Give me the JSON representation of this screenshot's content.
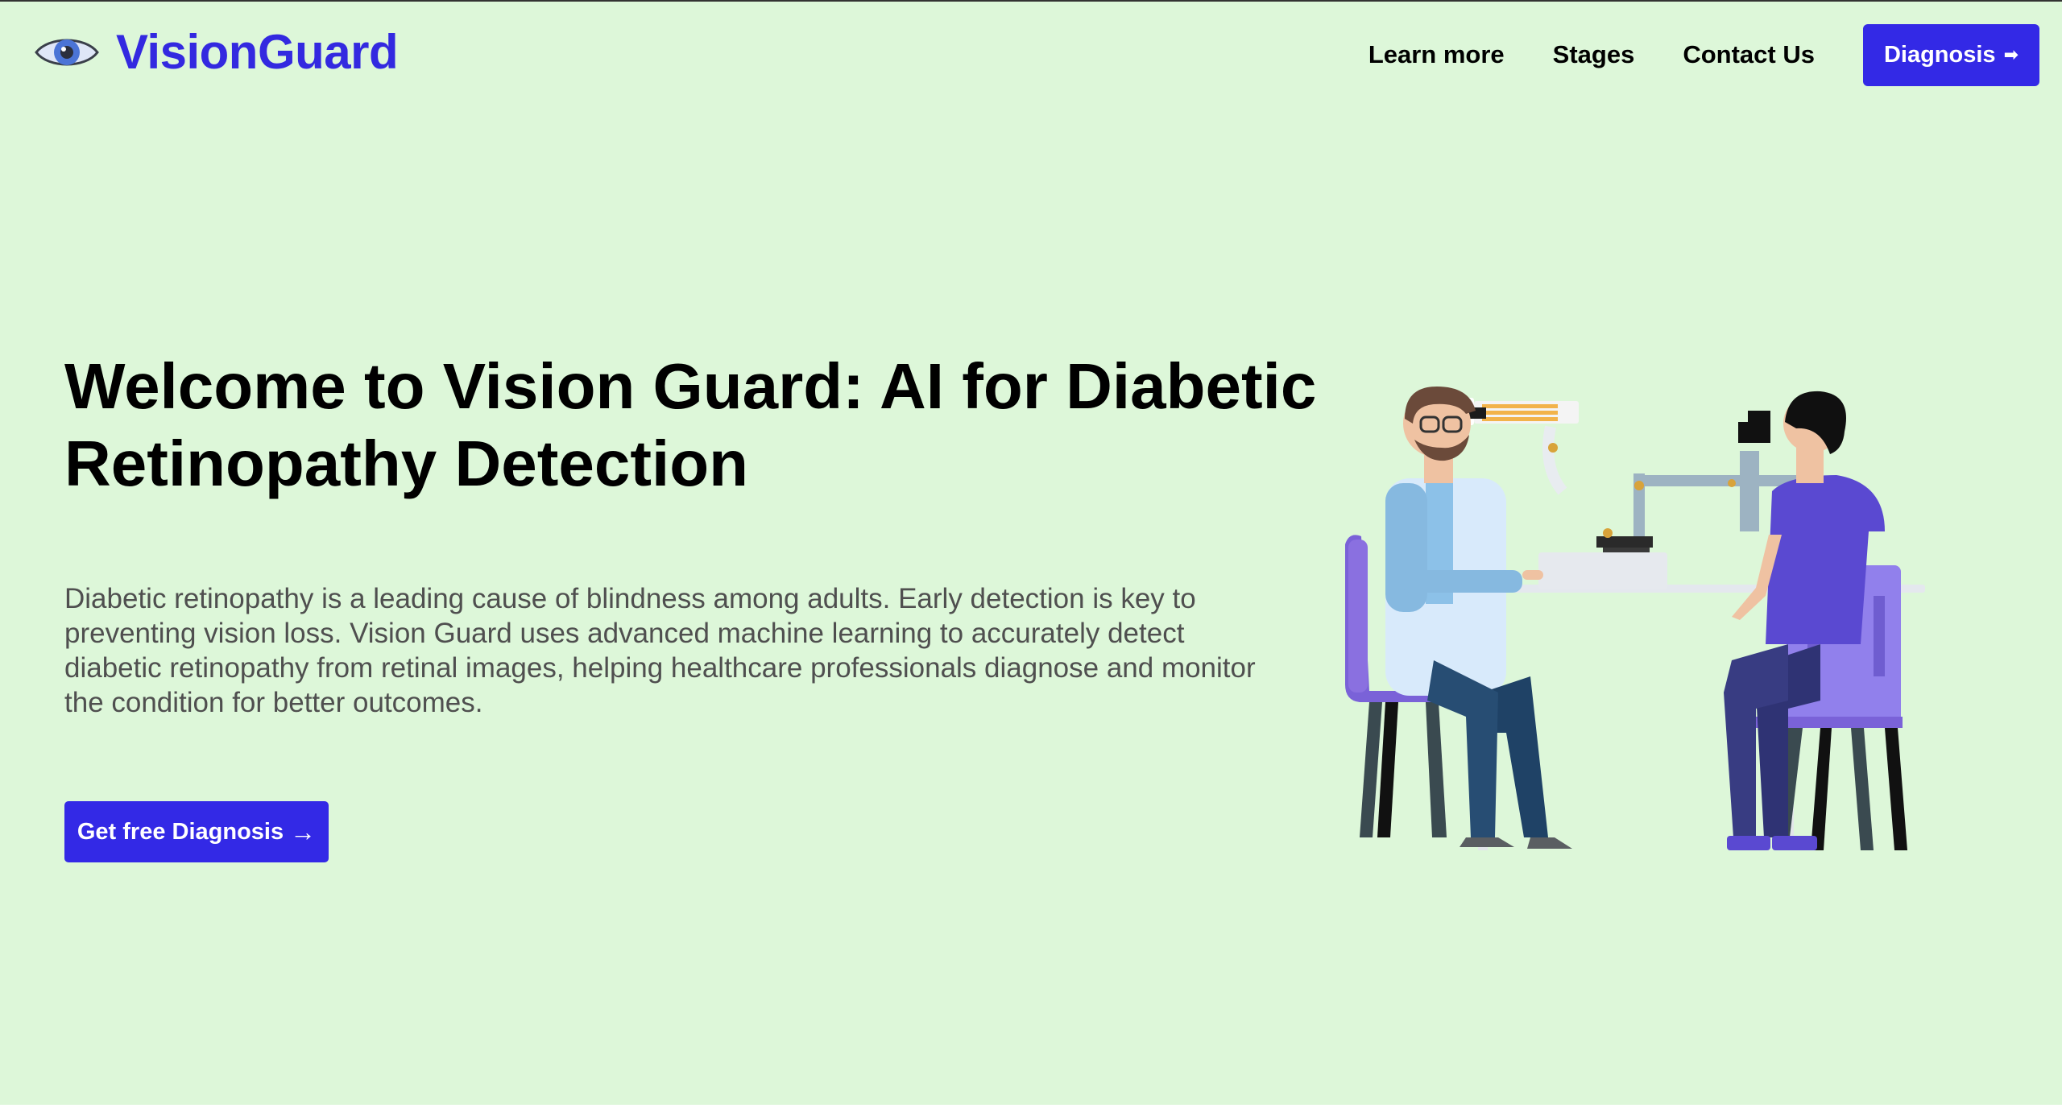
{
  "header": {
    "brand": "VisionGuard",
    "logo_icon": "eye-icon",
    "nav": {
      "learn_more": "Learn more",
      "stages": "Stages",
      "contact": "Contact Us",
      "diagnosis": "Diagnosis",
      "diagnosis_arrow": "➡"
    }
  },
  "hero": {
    "title": "Welcome to Vision Guard: AI for Diabetic Retinopathy Detection",
    "body": "Diabetic retinopathy is a leading cause of blindness among adults. Early detection is key to preventing vision loss. Vision Guard uses advanced machine learning to accurately detect diabetic retinopathy from retinal images, helping healthcare professionals diagnose and monitor the condition for better outcomes.",
    "cta_label": "Get free Diagnosis",
    "cta_arrow": "→"
  },
  "illustration": {
    "name": "eye-exam-illustration",
    "colors": {
      "background": "#ddf7d9",
      "brand": "#3329e0",
      "button": "#3329e6",
      "chair": "#8a70e0",
      "patient_shirt": "#5a49d1",
      "doctor_coat": "#d8eafb",
      "doctor_pants": "#1f4266"
    }
  }
}
